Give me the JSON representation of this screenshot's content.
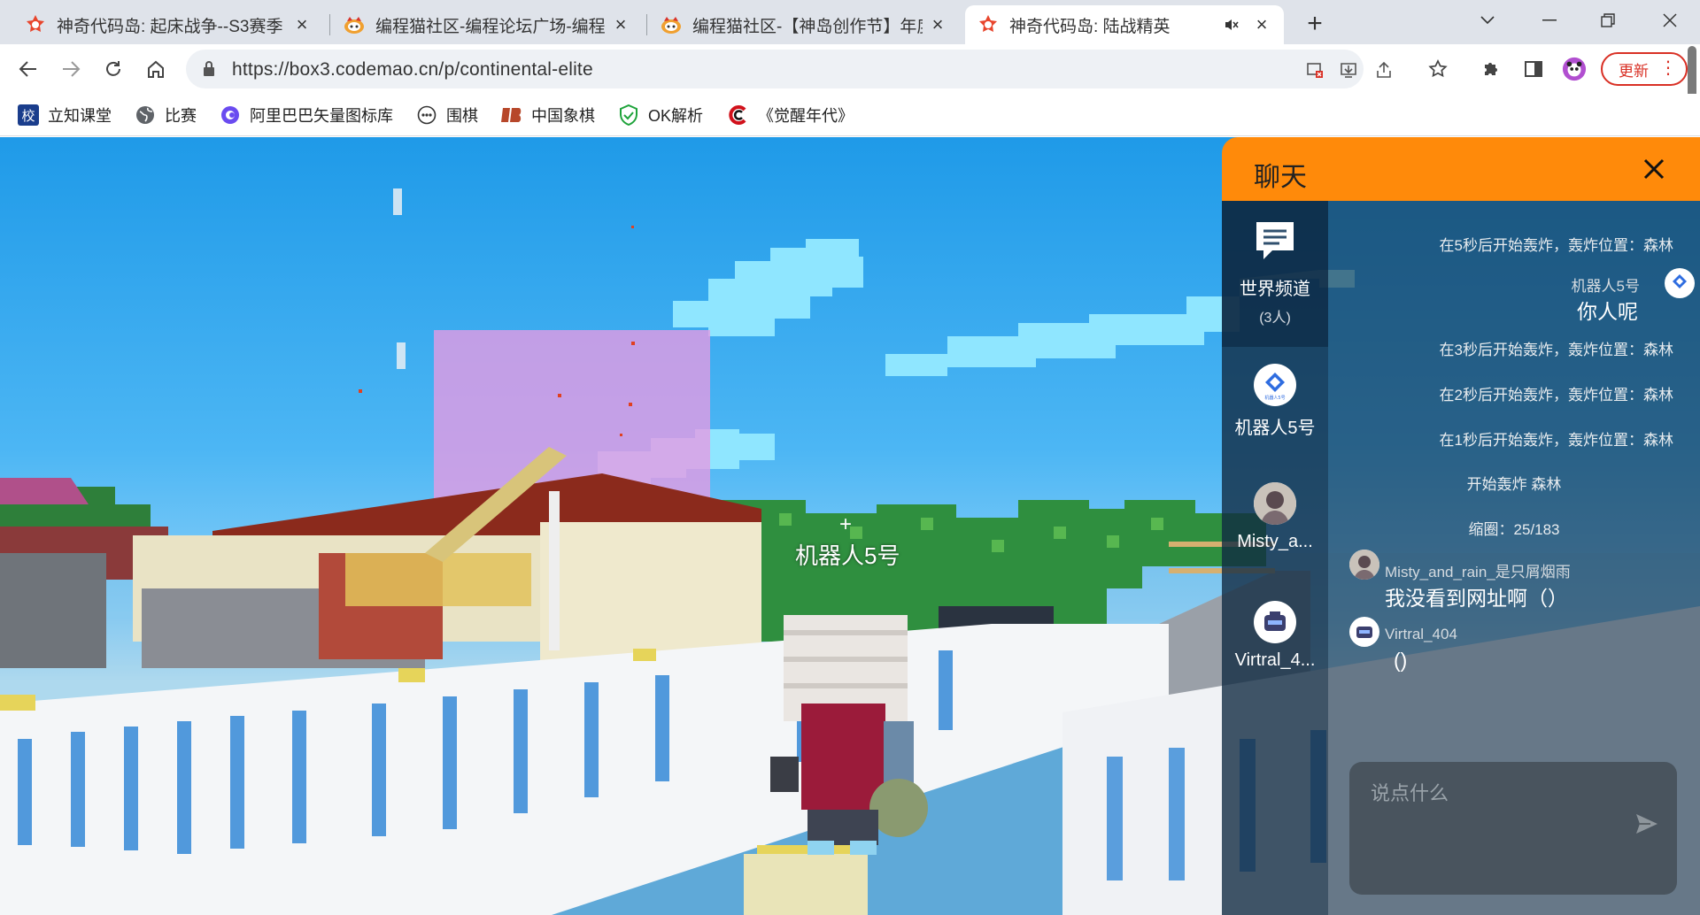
{
  "browser": {
    "tabs": [
      {
        "title": "神奇代码岛: 起床战争--S3赛季",
        "icon": "codemao-island-favicon"
      },
      {
        "title": "编程猫社区-编程论坛广场-编程学",
        "icon": "codemao-community-favicon"
      },
      {
        "title": "编程猫社区-【神岛创作节】年度",
        "icon": "codemao-community-favicon"
      },
      {
        "title": "神奇代码岛: 陆战精英",
        "icon": "codemao-island-favicon",
        "active": true
      }
    ],
    "url": "https://box3.codemao.cn/p/continental-elite",
    "update_label": "更新",
    "bookmarks": [
      {
        "label": "立知课堂",
        "icon": "lizhi-icon"
      },
      {
        "label": "比赛",
        "icon": "globe-icon"
      },
      {
        "label": "阿里巴巴矢量图标库",
        "icon": "iconfont-icon"
      },
      {
        "label": "围棋",
        "icon": "go-icon"
      },
      {
        "label": "中国象棋",
        "icon": "chess-icon"
      },
      {
        "label": "OK解析",
        "icon": "shield-check-icon"
      },
      {
        "label": "《觉醒年代》",
        "icon": "c-logo-icon"
      }
    ]
  },
  "game": {
    "player_name_tag": "机器人5号",
    "crosshair": "+"
  },
  "chat": {
    "title": "聊天",
    "channels": [
      {
        "name": "世界频道",
        "count": "(3人)"
      },
      {
        "name": "机器人5号"
      },
      {
        "name": "Misty_a..."
      },
      {
        "name": "Virtral_4..."
      }
    ],
    "messages": {
      "sys1": "在5秒后开始轰炸，轰炸位置：森林",
      "robot_name": "机器人5号",
      "robot_text": "你人呢",
      "sys2": "在3秒后开始轰炸，轰炸位置：森林",
      "sys3": "在2秒后开始轰炸，轰炸位置：森林",
      "sys4": "在1秒后开始轰炸，轰炸位置：森林",
      "sys5": "开始轰炸 森林",
      "sys6": "缩圈：25/183",
      "misty_name": "Misty_and_rain_是只屑烟雨",
      "misty_text": "我没看到网址啊（）",
      "virtral_name": "Virtral_404",
      "virtral_text": "()"
    },
    "input_placeholder": "说点什么"
  },
  "colors": {
    "chat_header": "#ff8a0a",
    "update_red": "#d93025",
    "sky": "#4cb6f4"
  }
}
